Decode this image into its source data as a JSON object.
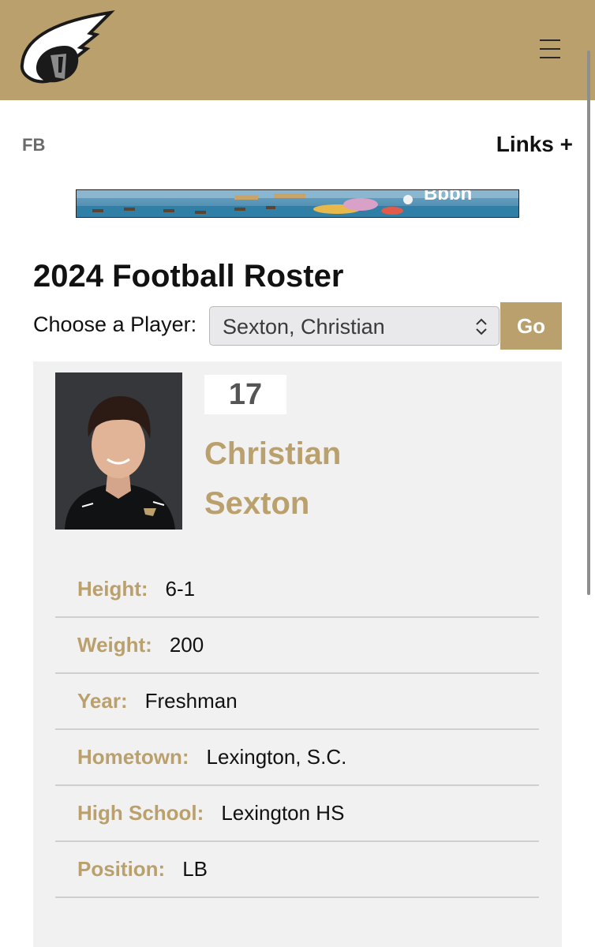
{
  "header": {
    "logo_icon": "spartan-helmet-logo",
    "menu_icon": "hamburger-menu-icon",
    "background_color": "#b9a06d"
  },
  "subnav": {
    "sport": "FB",
    "links_label": "Links +"
  },
  "banner": {
    "icon": "advertisement-banner-image"
  },
  "roster": {
    "title": "2024 Football Roster",
    "choose_label": "Choose a Player:",
    "selected_player": "Sexton, Christian",
    "go_label": "Go"
  },
  "player": {
    "number": "17",
    "first_name": "Christian",
    "last_name": "Sexton",
    "photo_icon": "player-headshot-photo",
    "stats": [
      {
        "label": "Height:",
        "value": "6-1"
      },
      {
        "label": "Weight:",
        "value": "200"
      },
      {
        "label": "Year:",
        "value": "Freshman"
      },
      {
        "label": "Hometown:",
        "value": "Lexington, S.C."
      },
      {
        "label": "High School:",
        "value": "Lexington HS"
      },
      {
        "label": "Position:",
        "value": "LB"
      }
    ]
  },
  "colors": {
    "accent_gold": "#b9a06d",
    "card_background": "#f1f1f1"
  }
}
